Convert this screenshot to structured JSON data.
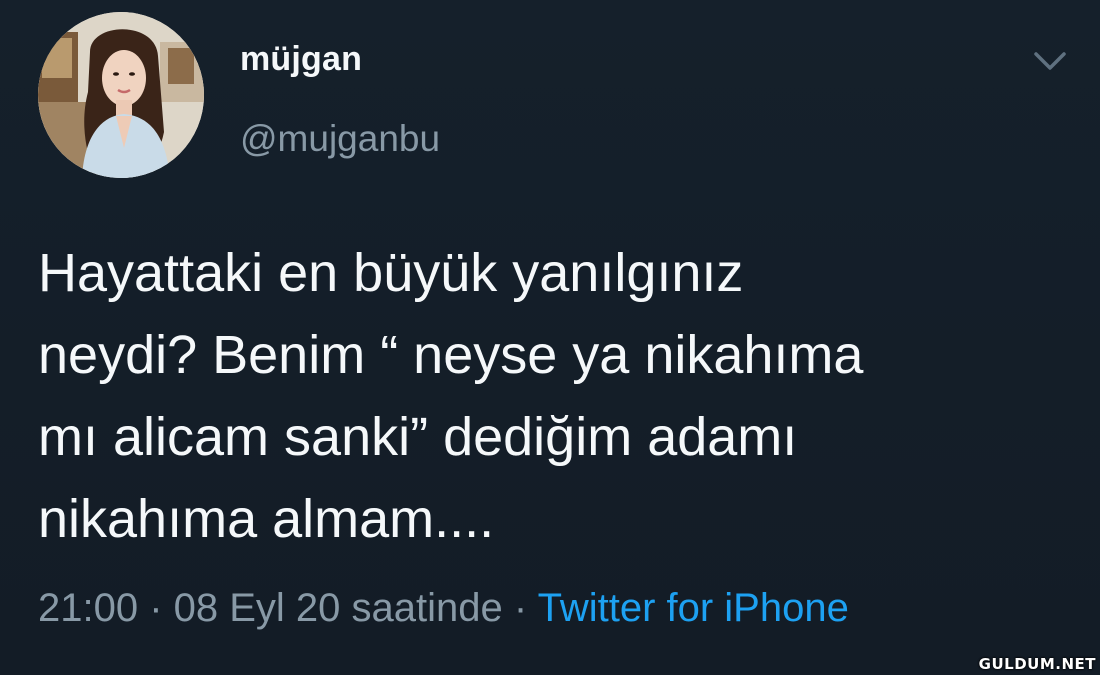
{
  "user": {
    "display_name": "müjgan",
    "handle": "@mujganbu"
  },
  "tweet": {
    "text": "Hayattaki en büyük yanılgınız\nneydi? Benim “ neyse ya nikahıma\nmı alicam sanki” dediğim adamı\nnikahıma almam....",
    "timestamp": "21:00 · 08 Eyl 20 saatinde",
    "separator": " · ",
    "source": "Twitter for iPhone"
  },
  "icons": {
    "menu": "chevron-down-icon",
    "avatar": "avatar"
  },
  "colors": {
    "background": "#15202b",
    "text": "#f5f8fa",
    "secondary": "#8899a6",
    "link": "#1da1f2"
  },
  "watermark": "GULDUM.NET"
}
